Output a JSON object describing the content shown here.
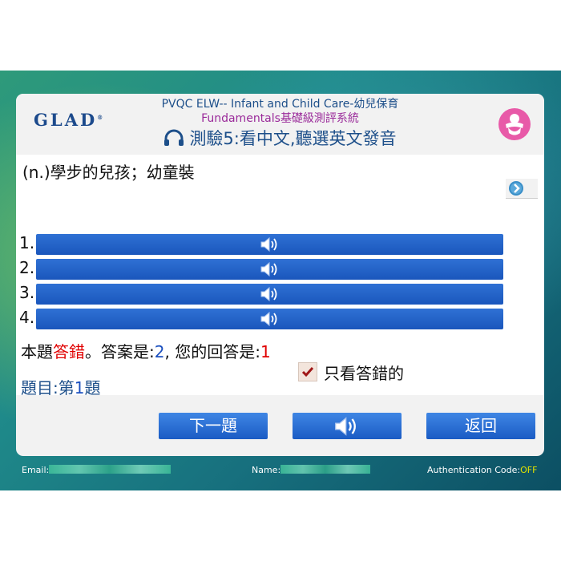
{
  "header": {
    "logo_text": "GLAD",
    "logo_mark": "®",
    "title_line1": "PVQC ELW-- Infant and Child Care-幼兒保育",
    "title_line2": "Fundamentals基礎級測評系統",
    "title_line3": "測驗5:看中文,聽選英文發音",
    "headphones_icon": "headphones-icon",
    "avatar_icon": "baby-icon"
  },
  "question": {
    "prompt": "(n.)學步的兒孩；幼童裝"
  },
  "options": [
    {
      "number": "1.",
      "icon": "speaker-icon"
    },
    {
      "number": "2.",
      "icon": "speaker-icon"
    },
    {
      "number": "3.",
      "icon": "speaker-icon"
    },
    {
      "number": "4.",
      "icon": "speaker-icon"
    }
  ],
  "result": {
    "prefix": "本題",
    "status": "答錯",
    "middle": "。答案是:",
    "answer": "2",
    "your_answer_label": ", 您的回答是:",
    "your_answer": "1"
  },
  "filter": {
    "label": "只看答錯的",
    "checked": true
  },
  "progress": {
    "prefix": "題目:第",
    "number": "1",
    "suffix": "題"
  },
  "buttons": {
    "next": "下一題",
    "play": "speaker-icon",
    "back": "返回"
  },
  "footer": {
    "email_label": "Email:",
    "name_label": "Name:",
    "auth_label": "Authentication Code:",
    "auth_value": "OFF"
  },
  "colors": {
    "option_bar": "#1a56bc",
    "wrong": "#e00000",
    "answer": "#1a4fbf",
    "title": "#1d4f8a",
    "subtitle": "#9a2a9a"
  }
}
